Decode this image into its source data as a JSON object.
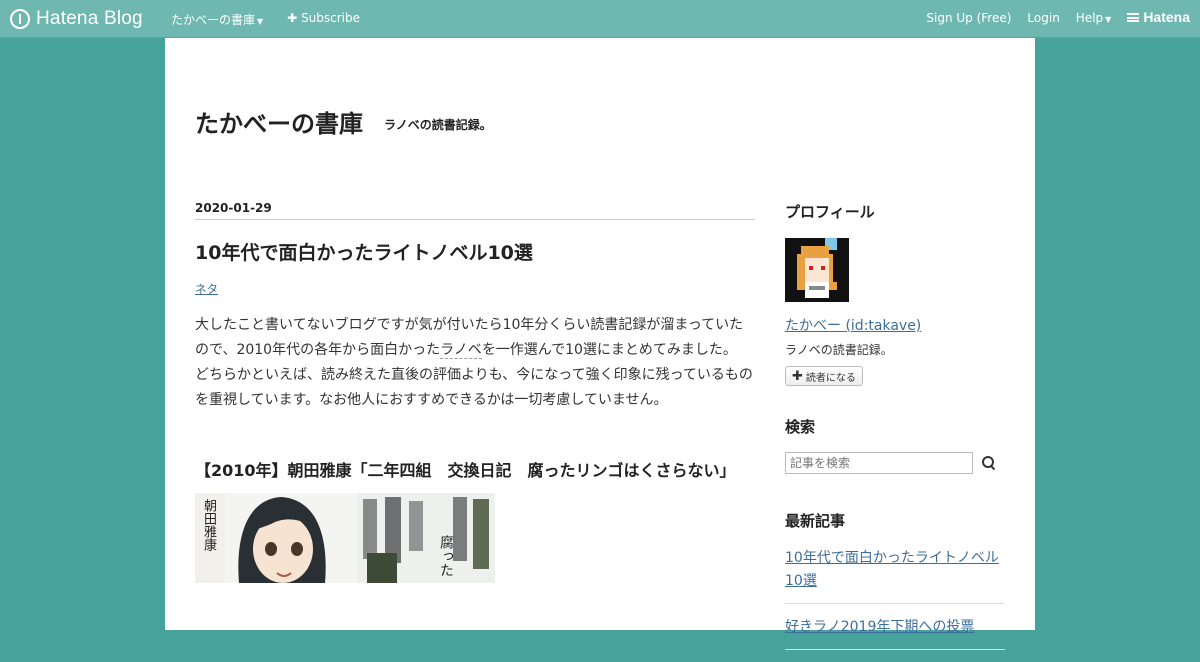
{
  "topbar": {
    "brand": "Hatena Blog",
    "blog_menu": "たかべーの書庫",
    "subscribe": "Subscribe",
    "signup": "Sign Up (Free)",
    "login": "Login",
    "help": "Help",
    "hatena": "Hatena",
    "colors": {
      "bar": "#6fb7b1",
      "background": "#45a39b"
    }
  },
  "blog": {
    "title": "たかべーの書庫",
    "description": "ラノベの読書記録。"
  },
  "entry": {
    "date": "2020-01-29",
    "title": "10年代で面白かったライトノベル10選",
    "category": "ネタ",
    "body": {
      "p1_before": "大したこと書いてないブログですが気が付いたら10年分くらい読書記録が溜まっていたので、2010年代の各年から面白かった",
      "p1_keyword": "ラノベ",
      "p1_after": "を一作選んで10選にまとめてみました。",
      "p2": "どちらかといえば、読み終えた直後の評価よりも、今になって強く印象に残っているものを重視しています。なお他人におすすめできるかは一切考慮していません。"
    },
    "section_heading": "【2010年】朝田雅康「二年四組　交換日記　腐ったリンゴはくさらない」",
    "cover_author_vertical": "朝田雅康",
    "cover_title_vertical": "腐った"
  },
  "sidebar": {
    "profile_heading": "プロフィール",
    "profile_name": "たかべー (id:takave)",
    "profile_desc": "ラノベの読書記録。",
    "reader_button": "読者になる",
    "search_heading": "検索",
    "search_placeholder": "記事を検索",
    "recent_heading": "最新記事",
    "recent_items": [
      "10年代で面白かったライトノベル10選",
      "好きラノ2019年下期への投票"
    ]
  }
}
